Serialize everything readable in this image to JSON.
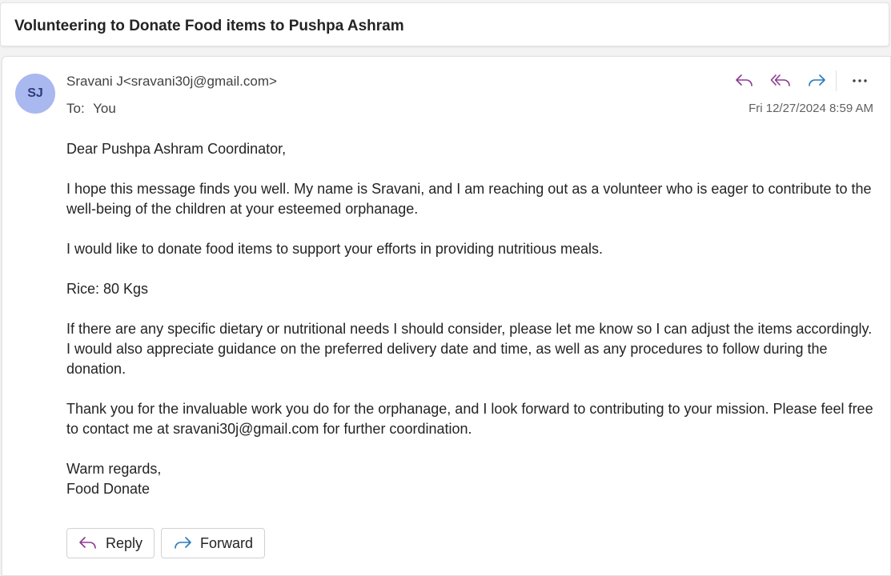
{
  "email": {
    "subject": "Volunteering to Donate Food items to Pushpa Ashram",
    "avatar_initials": "SJ",
    "sender": "Sravani J<sravani30j@gmail.com>",
    "to_label": "To:",
    "to_value": "You",
    "date": "Fri 12/27/2024 8:59 AM",
    "body": [
      "Dear Pushpa Ashram Coordinator,",
      "I hope this message finds you well. My name is Sravani, and I am reaching out as a volunteer who is eager to contribute to the well-being of the children at your esteemed orphanage.",
      "I would like to donate food items to support your efforts in providing nutritious meals.",
      "Rice: 80 Kgs",
      "If there are any specific dietary or nutritional needs I should consider, please let me know so I can adjust the items accordingly. I would also appreciate guidance on the preferred delivery date and time, as well as any procedures to follow during the donation.",
      "Thank you for the invaluable work you do for the orphanage, and I look forward to contributing to your mission. Please feel free to contact me at  sravani30j@gmail.com for further coordination."
    ],
    "closing": "Warm regards,",
    "signature": "Food Donate"
  },
  "buttons": {
    "reply_label": "Reply",
    "forward_label": "Forward"
  },
  "icons": {
    "reply": "reply-icon",
    "reply_all": "reply-all-icon",
    "forward": "forward-icon",
    "more": "more-icon"
  },
  "colors": {
    "reply_accent": "#8a3b8f",
    "forward_accent": "#2a7ab8",
    "avatar_bg": "#a9b8ef",
    "avatar_text": "#2f3a7a"
  }
}
